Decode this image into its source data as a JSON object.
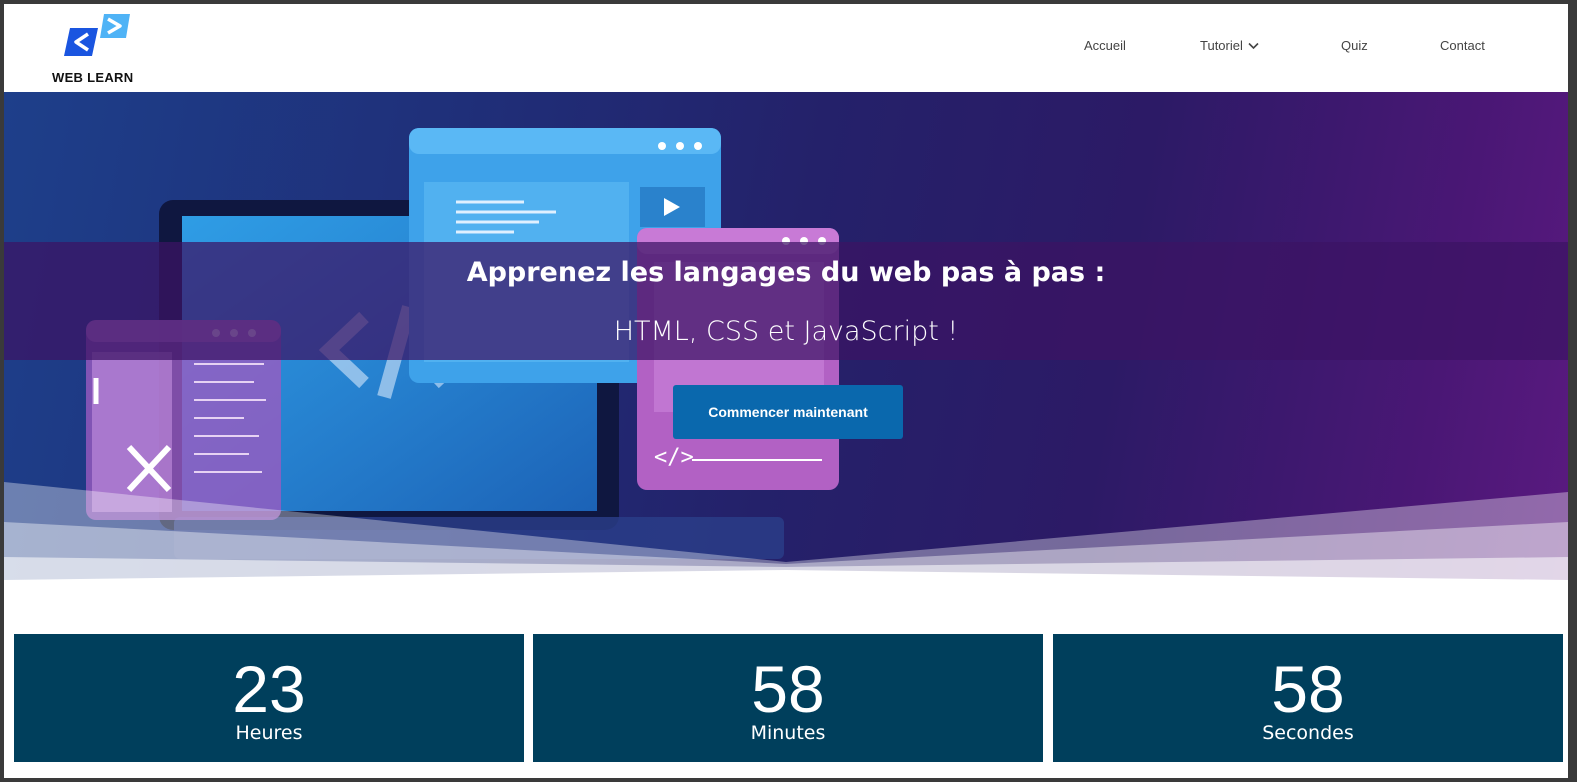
{
  "brand": {
    "name": "WEB LEARN",
    "accent": "#1a73e8",
    "accent_light": "#4fb3f6"
  },
  "nav": {
    "items": [
      {
        "label": "Accueil"
      },
      {
        "label": "Tutoriel",
        "has_dropdown": true
      },
      {
        "label": "Quiz"
      },
      {
        "label": "Contact"
      }
    ]
  },
  "hero": {
    "title": "Apprenez les langages du web pas à pas :",
    "subtitle": "HTML, CSS et JavaScript !",
    "cta_label": "Commencer maintenant",
    "cta_color": "#0a68ad"
  },
  "countdown": {
    "tile_color": "#003f5c",
    "units": [
      {
        "value": "23",
        "label": "Heures"
      },
      {
        "value": "58",
        "label": "Minutes"
      },
      {
        "value": "58",
        "label": "Secondes"
      }
    ]
  }
}
